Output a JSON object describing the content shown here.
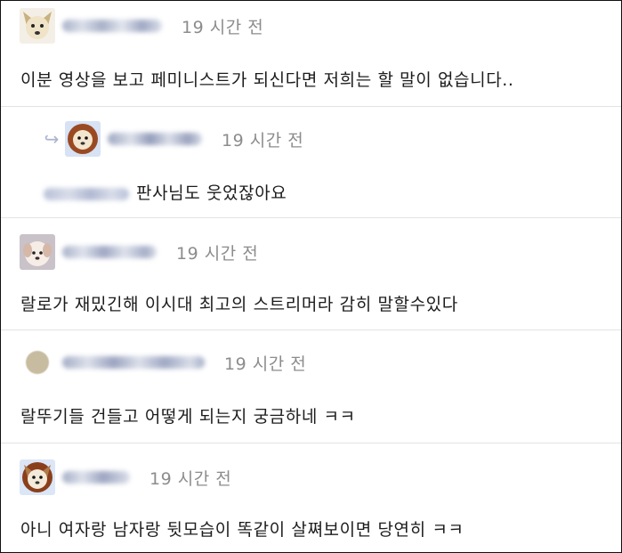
{
  "comments": [
    {
      "time": "19 시간 전",
      "text": "이분 영상을 보고 페미니스트가 되신다면 저희는 할 말이 없습니다.."
    },
    {
      "time": "19 시간 전",
      "text": "판사님도 웃었잖아요",
      "is_reply": true
    },
    {
      "time": "19 시간 전",
      "text": "랄로가 재밌긴해 이시대 최고의 스트리머라 감히 말할수있다"
    },
    {
      "time": "19 시간 전",
      "text": "랄뚜기들 건들고 어떻게 되는지 궁금하네 ㅋㅋ"
    },
    {
      "time": "19 시간 전",
      "text": "아니 여자랑 남자랑 뒷모습이 똑같이 살쪄보이면 당연히 ㅋㅋ"
    }
  ],
  "icons": {
    "avatar_1": "dog-avatar-icon",
    "avatar_2": "lion-avatar-icon",
    "avatar_3": "puppy-avatar-icon",
    "avatar_4": "default-avatar-icon",
    "avatar_5": "dog-avatar-icon",
    "reply": "reply-arrow-icon"
  },
  "colors": {
    "time": "#8c8c8c",
    "text": "#1c1c1c",
    "divider": "#e3e3e3"
  }
}
